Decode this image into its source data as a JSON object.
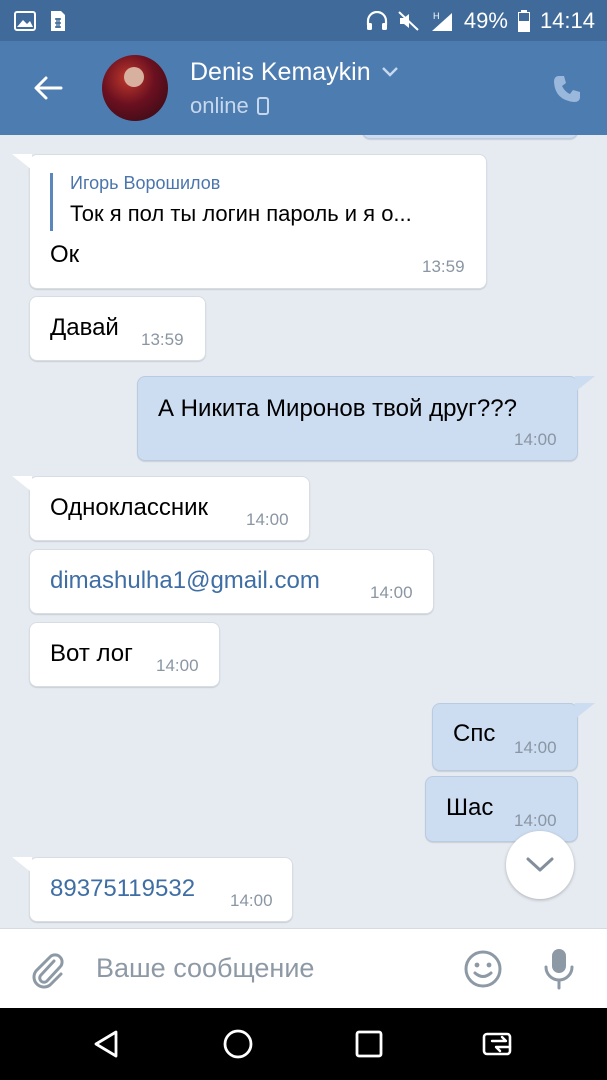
{
  "status_bar": {
    "battery": "49%",
    "time": "14:14",
    "network": "H"
  },
  "header": {
    "contact_name": "Denis Kemaykin",
    "status": "online",
    "icons": [
      "back-arrow-icon",
      "chevron-down-icon",
      "mobile-device-icon",
      "phone-icon"
    ]
  },
  "messages": [
    {
      "direction": "in",
      "reply": {
        "author": "Игорь Ворошилов",
        "text": "Ток я пол ты логин пароль и я о..."
      },
      "text": "Ок",
      "time": "13:59"
    },
    {
      "direction": "in",
      "text": "Давай",
      "time": "13:59"
    },
    {
      "direction": "out",
      "text": "А Никита Миронов твой друг???",
      "time": "14:00"
    },
    {
      "direction": "in",
      "text": "Одноклассник",
      "time": "14:00"
    },
    {
      "direction": "in",
      "text": "dimashulha1@gmail.com",
      "time": "14:00",
      "is_link": true
    },
    {
      "direction": "in",
      "text": "Вот лог",
      "time": "14:00"
    },
    {
      "direction": "out",
      "text": "Спс",
      "time": "14:00"
    },
    {
      "direction": "out",
      "text": "Шас",
      "time": "14:00"
    },
    {
      "direction": "in",
      "text": "89375119532",
      "time": "14:00",
      "is_link": true
    }
  ],
  "composer": {
    "placeholder": "Ваше сообщение",
    "value": ""
  },
  "colors": {
    "status_bar": "#3f6a99",
    "header": "#4d7cb1",
    "chat_background": "#e6ebf1",
    "bubble_in": "#ffffff",
    "bubble_out": "#ccdcf1",
    "link": "#3f6ea5",
    "time": "#8a96a3"
  }
}
